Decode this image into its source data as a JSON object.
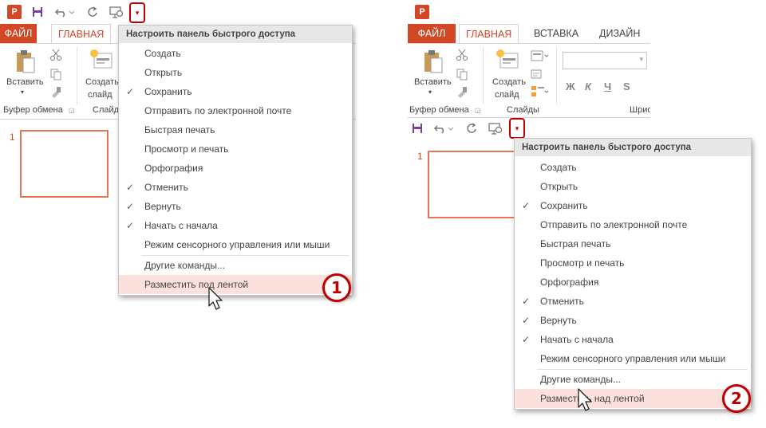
{
  "qat": {
    "logo": "P",
    "save_icon": "save-icon",
    "undo_icon": "undo-icon",
    "redo_icon": "redo-icon",
    "presenter_icon": "presenter-icon",
    "dropdown_glyph": "▾"
  },
  "tabs": {
    "file": "ФАЙЛ",
    "home": "ГЛАВНАЯ",
    "insert": "ВСТАВКА",
    "design": "ДИЗАЙН"
  },
  "ribbon": {
    "paste": "Вставить",
    "new_slide_line1": "Создать",
    "new_slide_line2": "слайд",
    "clipboard_group": "Буфер обмена",
    "slides_group_left": "Слайд",
    "slides_group_right": "Слайды",
    "font_group": "Шриф",
    "font_bold": "Ж",
    "font_italic": "К",
    "font_underline": "Ч",
    "font_strike": "S"
  },
  "slide": {
    "number": "1"
  },
  "menu": {
    "header": "Настроить панель быстрого доступа",
    "items": [
      {
        "label": "Создать",
        "checked": false
      },
      {
        "label": "Открыть",
        "checked": false
      },
      {
        "label": "Сохранить",
        "checked": true
      },
      {
        "label": "Отправить по электронной почте",
        "checked": false
      },
      {
        "label": "Быстрая печать",
        "checked": false
      },
      {
        "label": "Просмотр и печать",
        "checked": false
      },
      {
        "label": "Орфография",
        "checked": false
      },
      {
        "label": "Отменить",
        "checked": true
      },
      {
        "label": "Вернуть",
        "checked": true
      },
      {
        "label": "Начать с начала",
        "checked": true
      },
      {
        "label": "Режим сенсорного управления или мыши",
        "checked": false
      }
    ],
    "more_commands": "Другие команды...",
    "check_glyph": "✓"
  },
  "menu1": {
    "bottom_label": "Разместить под лентой"
  },
  "menu2": {
    "bottom_label": "Разместить над лентой"
  },
  "badges": {
    "first": "1",
    "second": "2"
  },
  "colors": {
    "accent": "#d24726",
    "highlight": "#fbe0dc",
    "badge": "#c00000"
  }
}
